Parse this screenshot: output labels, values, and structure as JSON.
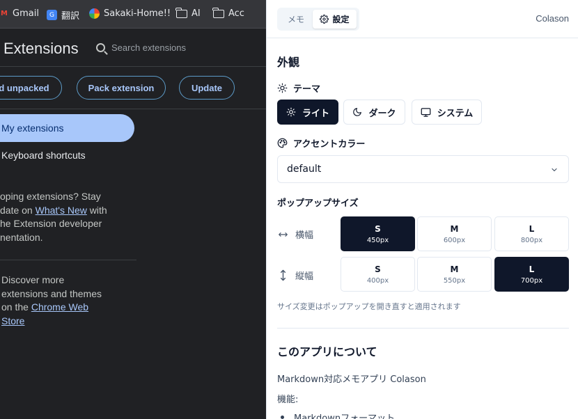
{
  "bookmarks": [
    {
      "label": "Gmail",
      "icon": "gmail-icon"
    },
    {
      "label": "翻訳",
      "icon": "translate-icon"
    },
    {
      "label": "Sakaki-Home!!",
      "icon": "chrome-icon"
    },
    {
      "label": "AI",
      "icon": "folder-icon"
    },
    {
      "label": "Acc",
      "icon": "folder-icon"
    }
  ],
  "extensions_page": {
    "title": "Extensions",
    "search_placeholder": "Search extensions",
    "load_unpacked": "d unpacked",
    "pack_extension": "Pack extension",
    "update": "Update",
    "nav_my_extensions": "My extensions",
    "nav_keyboard_shortcuts": "Keyboard shortcuts",
    "blurb": {
      "line1": "oping extensions? Stay",
      "line2_pre": "date on ",
      "line2_link": "What's New",
      "line2_post": " with",
      "line3": "he Extension developer",
      "line4": "nentation."
    },
    "store": {
      "line1": "Discover more",
      "line2": "extensions and themes",
      "line3_pre": "on the ",
      "line3_link": "Chrome Web",
      "line4_link": "Store"
    }
  },
  "panel": {
    "tabs": {
      "memo": "メモ",
      "settings": "設定"
    },
    "brand": "Colason",
    "appearance": {
      "title": "外観",
      "theme_label": "テーマ",
      "theme_options": {
        "light": "ライト",
        "dark": "ダーク",
        "system": "システム"
      },
      "theme_selected": "light",
      "accent_label": "アクセントカラー",
      "accent_value": "default"
    },
    "popup_size": {
      "title": "ポップアップサイズ",
      "width_label": "横幅",
      "height_label": "縦幅",
      "width_options": [
        {
          "size": "S",
          "px": "450px"
        },
        {
          "size": "M",
          "px": "600px"
        },
        {
          "size": "L",
          "px": "800px"
        }
      ],
      "width_selected": "S",
      "height_options": [
        {
          "size": "S",
          "px": "400px"
        },
        {
          "size": "M",
          "px": "550px"
        },
        {
          "size": "L",
          "px": "700px"
        }
      ],
      "height_selected": "L",
      "hint": "サイズ変更はポップアップを開き直すと適用されます"
    },
    "about": {
      "title": "このアプリについて",
      "description": "Markdown対応メモアプリ Colason",
      "features_label": "機能:",
      "feature_1": "Markdownフォーマット"
    }
  },
  "colors": {
    "primary": "#0f172a",
    "border": "#e2e8f0",
    "chrome_bg": "#202124",
    "chrome_accent": "#a8c7fa"
  }
}
